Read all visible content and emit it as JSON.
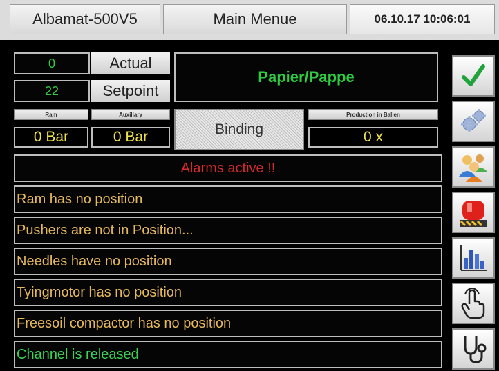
{
  "header": {
    "app_name": "Albamat-500V5",
    "menu_title": "Main Menue",
    "datetime": "06.10.17 10:06:01"
  },
  "counter": {
    "actual_value": "0",
    "actual_label": "Actual",
    "setpoint_value": "22",
    "setpoint_label": "Setpoint"
  },
  "material": {
    "name": "Papier/Pappe"
  },
  "gauges": {
    "ram_label": "Ram",
    "ram_value": "0 Bar",
    "aux_label": "Auxiliary",
    "aux_value": "0 Bar",
    "production_label": "Production in Ballen",
    "production_value": "0  x"
  },
  "binding": {
    "label": "Binding"
  },
  "messages": [
    {
      "text": "Alarms active !!",
      "type": "alarm"
    },
    {
      "text": "Ram has no position",
      "type": "warning"
    },
    {
      "text": "Pushers are not in Position...",
      "type": "warning"
    },
    {
      "text": "Needles have no position",
      "type": "warning"
    },
    {
      "text": "Tyingmotor has no position",
      "type": "warning"
    },
    {
      "text": "Freesoil compactor has no position",
      "type": "warning"
    },
    {
      "text": "Channel is released",
      "type": "ok"
    }
  ],
  "sidebar": {
    "items": [
      {
        "icon": "checkmark-icon"
      },
      {
        "icon": "gears-icon"
      },
      {
        "icon": "users-icon"
      },
      {
        "icon": "alarm-light-icon"
      },
      {
        "icon": "statistics-icon"
      },
      {
        "icon": "hand-pointer-icon"
      },
      {
        "icon": "stethoscope-icon"
      }
    ]
  },
  "colors": {
    "accent_green": "#2ecc40",
    "value_yellow": "#f2e24a",
    "alarm_red": "#d82a2a",
    "warning_orange": "#e6b85c"
  }
}
